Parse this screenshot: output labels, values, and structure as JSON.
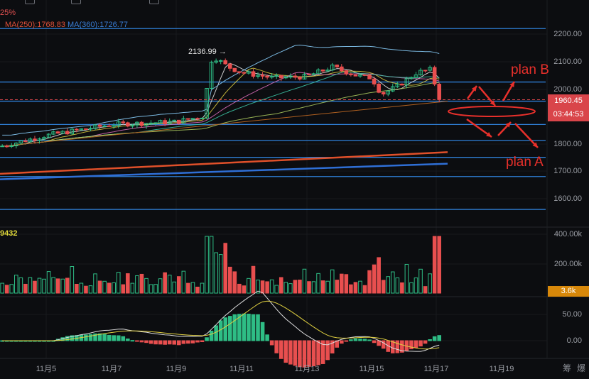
{
  "indicators": {
    "top_partial": "25%",
    "ma250": "MA(250):1768.83",
    "ma360": "MA(360):1726.77",
    "volume_partial": "9432"
  },
  "price_axis": [
    "2200.00",
    "2100.00",
    "2000.00",
    "1800.00",
    "1700.00",
    "1600.00"
  ],
  "current_price": "1960.45",
  "countdown": "03:44:53",
  "high_marker": "2136.99 →",
  "volume_axis": [
    "400.00k",
    "200.00k"
  ],
  "volume_badge": "3.6k",
  "macd_axis": [
    "50.00",
    "0.00"
  ],
  "dates": [
    "11月5",
    "11月7",
    "11月9",
    "11月11",
    "11月13",
    "11月15",
    "11月17",
    "11月19"
  ],
  "footer_icons": [
    "筹",
    "爆"
  ],
  "annotations": {
    "plan_a": "plan A",
    "plan_b": "plan B"
  },
  "colors": {
    "up": "#2ebd85",
    "down": "#e84f4f",
    "level": "#2f7fd6",
    "annotation": "#e8302b",
    "badge_price": "#d9454a",
    "badge_volume": "#d8880a"
  },
  "chart_data": {
    "type": "candlestick",
    "price_path": [
      [
        3.6,
        1790
      ],
      [
        5,
        1830
      ],
      [
        7,
        1870
      ],
      [
        9,
        1880
      ],
      [
        9.8,
        1900
      ],
      [
        10.1,
        2120
      ],
      [
        10.6,
        2080
      ],
      [
        11,
        2060
      ],
      [
        12,
        2040
      ],
      [
        13,
        2045
      ],
      [
        13.8,
        2080
      ],
      [
        14.5,
        2050
      ],
      [
        15,
        2040
      ],
      [
        15.3,
        1980
      ],
      [
        15.8,
        2010
      ],
      [
        16.4,
        2060
      ],
      [
        16.8,
        2070
      ],
      [
        17.1,
        1960
      ]
    ],
    "levels": [
      2220,
      2025,
      1955,
      1870,
      1812,
      1750,
      1680,
      1560
    ],
    "ma250": 1768.83,
    "ma360": 1726.77
  }
}
